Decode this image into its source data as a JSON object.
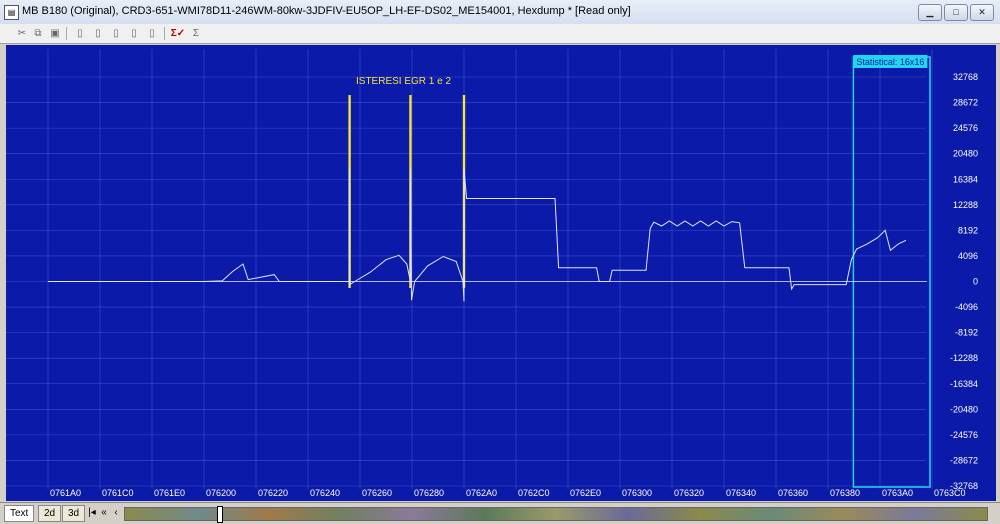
{
  "window": {
    "title": "MB B180 (Original), CRD3-651-WMI78D11-246WM-80kw-3JDFIV-EU5OP_LH-EF-DS02_ME154001, Hexdump *   [Read only]",
    "app_icon": "winols-icon",
    "buttons": [
      "minimize-icon",
      "maximize-icon",
      "close-icon"
    ]
  },
  "toolbar": {
    "icons": [
      "cut-icon",
      "copy-icon",
      "paste-icon",
      "map-add-icon",
      "map-remove-icon",
      "map-prev-icon",
      "map-next-icon",
      "map-copy-icon",
      "sigma-check-icon",
      "sigma-icon"
    ]
  },
  "graph": {
    "annotation": "ISTERESI EGR 1 e 2",
    "statistical_label": "Statistical: 16x16",
    "colors": {
      "background": "#0b1aa8",
      "grid": "#3c51c9",
      "line": "#e0e4ff",
      "marker": "#f5e23a",
      "selection": "#21d7ee"
    }
  },
  "chart_data": {
    "type": "line",
    "y_ticks": [
      "32768",
      "28672",
      "24576",
      "20480",
      "16384",
      "12288",
      "8192",
      "4096",
      "0",
      "-4096",
      "-8192",
      "-12288",
      "-16384",
      "-20480",
      "-24576",
      "-28672",
      "-32768"
    ],
    "x_ticks": [
      "0761A0",
      "0761C0",
      "0761E0",
      "076200",
      "076220",
      "076240",
      "076260",
      "076280",
      "0762A0",
      "0762C0",
      "0762E0",
      "076300",
      "076320",
      "076340",
      "076360",
      "076380",
      "0763A0",
      "0763C0"
    ],
    "ylim": [
      -32768,
      32768
    ],
    "xlim": [
      0,
      17
    ],
    "series": [
      {
        "points": [
          [
            0,
            0
          ],
          [
            0.02,
            0
          ],
          [
            3.0,
            0
          ],
          [
            3.35,
            100
          ],
          [
            3.55,
            1600
          ],
          [
            3.75,
            2800
          ],
          [
            3.85,
            300
          ],
          [
            4.1,
            700
          ],
          [
            4.35,
            1100
          ],
          [
            4.45,
            0
          ],
          [
            5.2,
            0
          ],
          [
            5.8,
            0
          ],
          [
            5.8,
            18000
          ],
          [
            5.8,
            -500
          ],
          [
            5.9,
            0
          ],
          [
            6.2,
            1500
          ],
          [
            6.5,
            3500
          ],
          [
            6.75,
            4200
          ],
          [
            6.9,
            2800
          ],
          [
            6.97,
            0
          ],
          [
            6.97,
            18000
          ],
          [
            6.99,
            -3000
          ],
          [
            7.05,
            0
          ],
          [
            7.3,
            2500
          ],
          [
            7.6,
            4000
          ],
          [
            7.85,
            3200
          ],
          [
            7.98,
            0
          ],
          [
            8.0,
            -3200
          ],
          [
            8.0,
            18000
          ],
          [
            8.05,
            13300
          ],
          [
            9.75,
            13300
          ],
          [
            9.82,
            2200
          ],
          [
            10.55,
            2200
          ],
          [
            10.6,
            0
          ],
          [
            10.8,
            0
          ],
          [
            10.85,
            1800
          ],
          [
            11.5,
            1800
          ],
          [
            11.58,
            8500
          ],
          [
            11.65,
            9500
          ],
          [
            11.8,
            8900
          ],
          [
            11.95,
            9700
          ],
          [
            12.1,
            8900
          ],
          [
            12.25,
            9700
          ],
          [
            12.4,
            8900
          ],
          [
            12.55,
            9700
          ],
          [
            12.7,
            8900
          ],
          [
            12.85,
            9700
          ],
          [
            13.0,
            8900
          ],
          [
            13.15,
            9600
          ],
          [
            13.3,
            9400
          ],
          [
            13.4,
            2200
          ],
          [
            14.25,
            2200
          ],
          [
            14.3,
            -1200
          ],
          [
            14.35,
            -500
          ],
          [
            15.35,
            -500
          ],
          [
            15.45,
            3500
          ],
          [
            15.55,
            5200
          ],
          [
            15.75,
            6000
          ],
          [
            15.95,
            7000
          ],
          [
            16.1,
            8200
          ],
          [
            16.2,
            5000
          ],
          [
            16.35,
            6000
          ],
          [
            16.5,
            6600
          ]
        ]
      }
    ],
    "markers": [
      5.8,
      6.97,
      8.0
    ],
    "selection": {
      "from": 15.45,
      "to": 17
    }
  },
  "bottom": {
    "tabs": [
      "Text",
      "2d",
      "3d"
    ],
    "nav": [
      "first-icon",
      "prev-page-icon",
      "prev-icon",
      "next-icon",
      "next-page-icon",
      "last-icon"
    ],
    "overview_label": "data-overview-strip"
  }
}
